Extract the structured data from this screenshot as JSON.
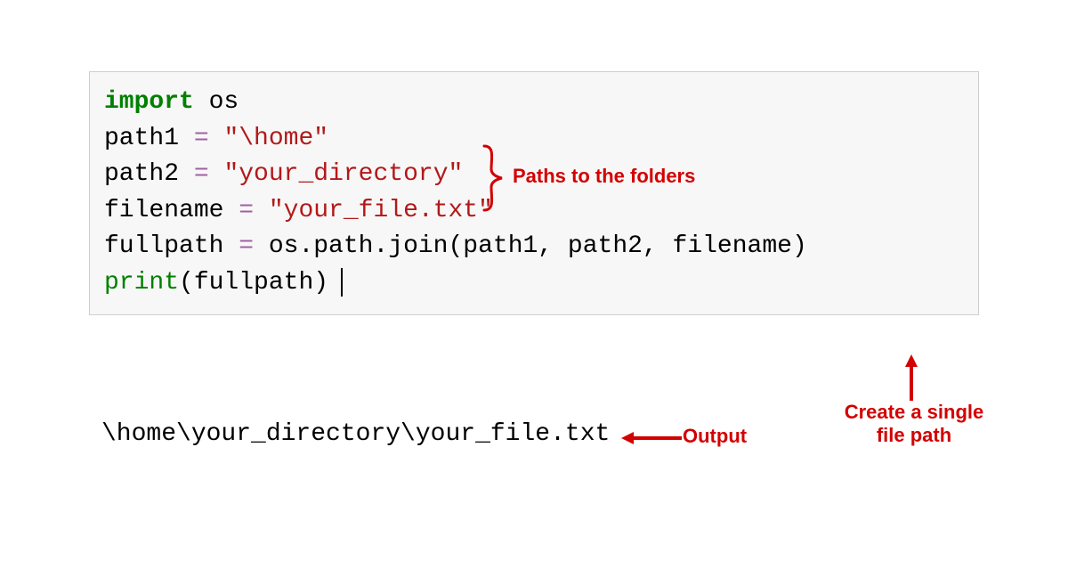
{
  "code": {
    "line1_import": "import",
    "line1_mod": " os",
    "line2": "",
    "line3_var": "path1 ",
    "line3_eq": "=",
    "line3_sp": " ",
    "line3_str": "\"\\home\"",
    "line4_var": "path2 ",
    "line4_eq": "=",
    "line4_sp": " ",
    "line4_str": "\"your_directory\"",
    "line5_var": "filename ",
    "line5_eq": "=",
    "line5_sp": " ",
    "line5_str": "\"your_file.txt\"",
    "line6": "",
    "line7_var": "fullpath ",
    "line7_eq": "=",
    "line7_rest": " os.path.join(path1, path2, filename)",
    "line8_fn": "print",
    "line8_rest": "(fullpath)"
  },
  "output": "\\home\\your_directory\\your_file.txt",
  "annotations": {
    "paths": "Paths to the folders",
    "output": "Output",
    "create": "Create a single file path"
  }
}
